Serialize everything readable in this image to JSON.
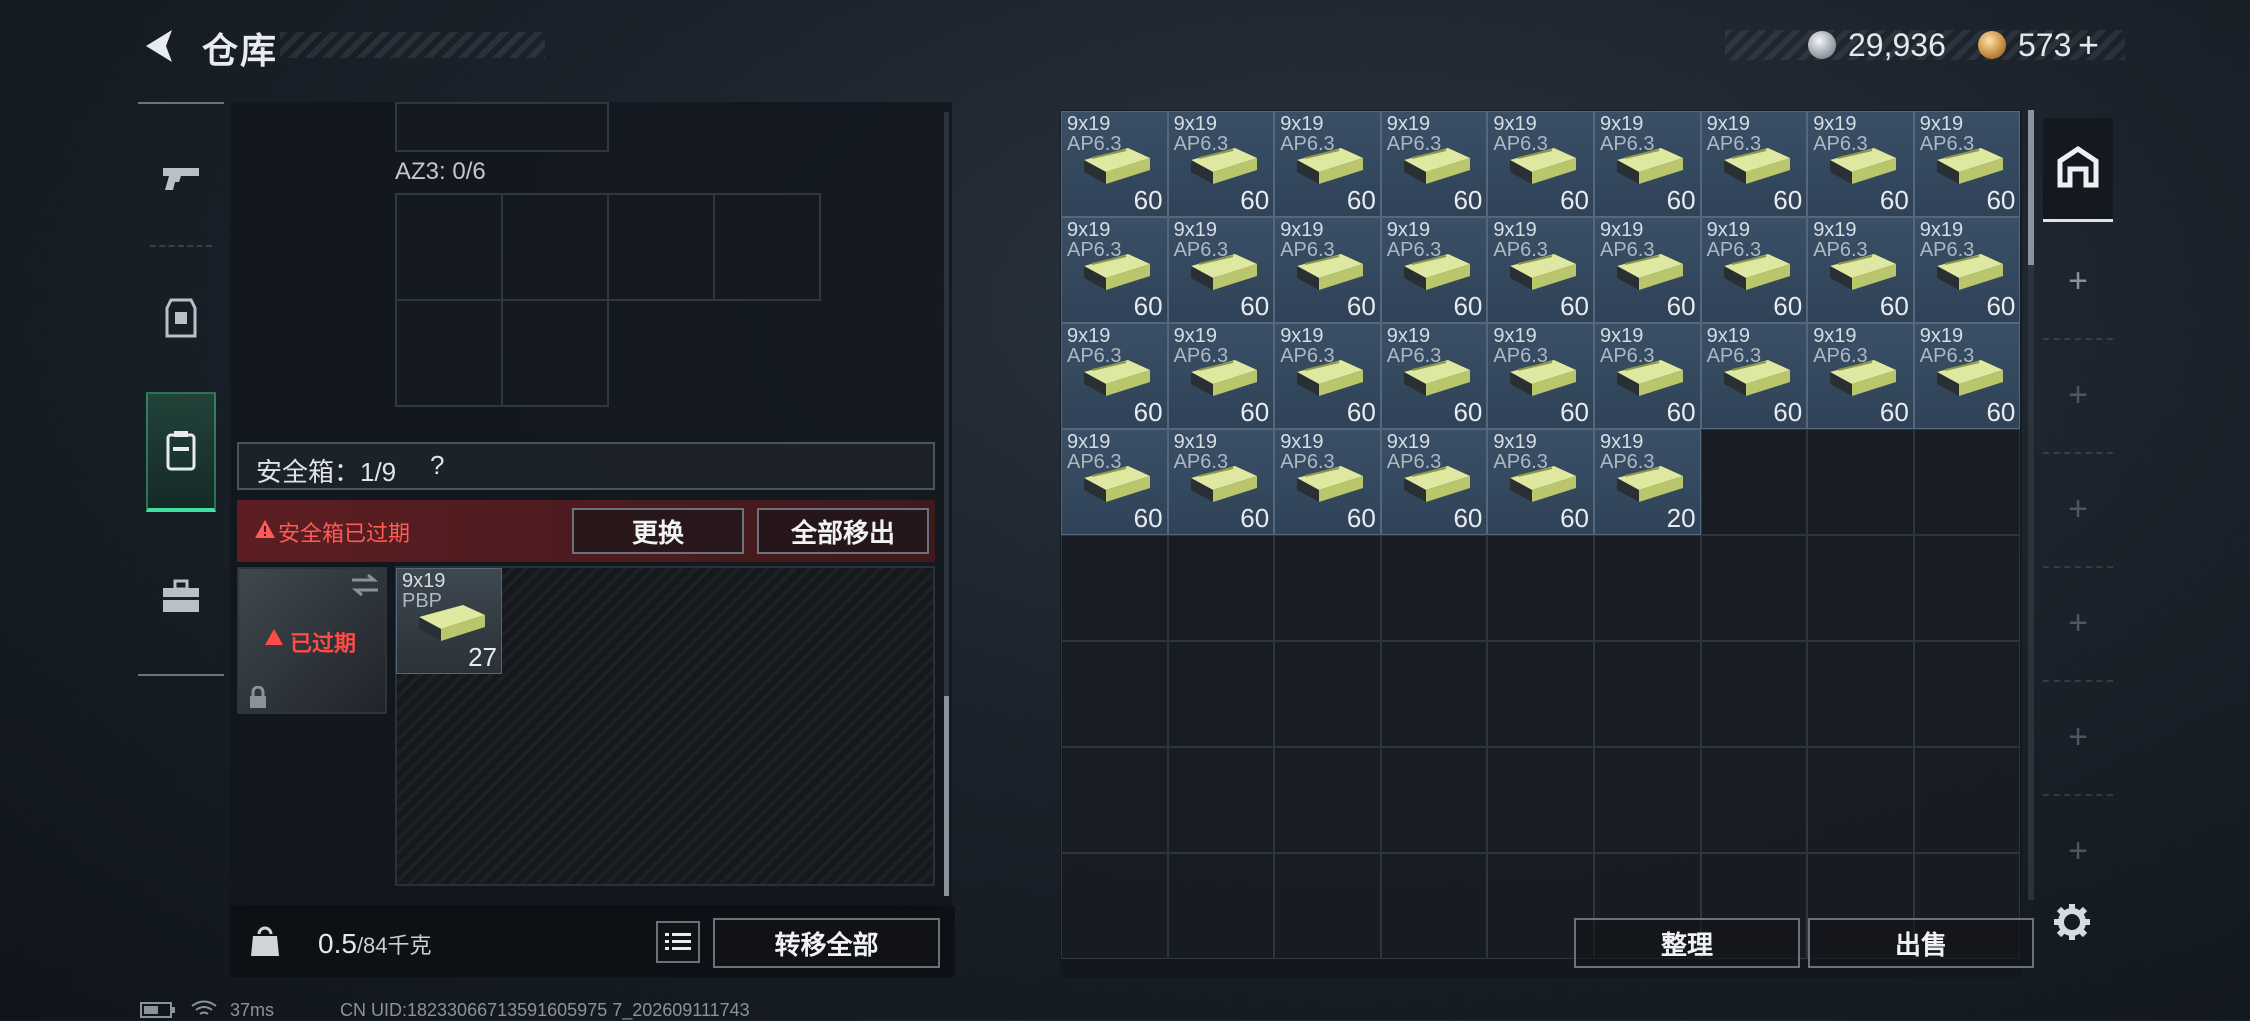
{
  "header": {
    "title": "仓库",
    "currency_silver": "29,936",
    "currency_gold": "573",
    "currency_add": "+"
  },
  "left": {
    "az3_label": "AZ3: 0/6",
    "safebox_label": "安全箱：1/9",
    "safebox_help": "?",
    "expired_warning": "安全箱已过期",
    "btn_replace": "更换",
    "btn_move_all_out": "全部移出",
    "safe_expired_badge": "已过期",
    "safe_item": {
      "name": "9x19",
      "sub": "PBP",
      "count": "27"
    },
    "weight_value": "0.5",
    "weight_unit": "/84千克",
    "btn_transfer_all": "转移全部"
  },
  "right": {
    "items": [
      {
        "name": "9x19",
        "sub": "AP6.3",
        "count": "60"
      },
      {
        "name": "9x19",
        "sub": "AP6.3",
        "count": "60"
      },
      {
        "name": "9x19",
        "sub": "AP6.3",
        "count": "60"
      },
      {
        "name": "9x19",
        "sub": "AP6.3",
        "count": "60"
      },
      {
        "name": "9x19",
        "sub": "AP6.3",
        "count": "60"
      },
      {
        "name": "9x19",
        "sub": "AP6.3",
        "count": "60"
      },
      {
        "name": "9x19",
        "sub": "AP6.3",
        "count": "60"
      },
      {
        "name": "9x19",
        "sub": "AP6.3",
        "count": "60"
      },
      {
        "name": "9x19",
        "sub": "AP6.3",
        "count": "60"
      },
      {
        "name": "9x19",
        "sub": "AP6.3",
        "count": "60"
      },
      {
        "name": "9x19",
        "sub": "AP6.3",
        "count": "60"
      },
      {
        "name": "9x19",
        "sub": "AP6.3",
        "count": "60"
      },
      {
        "name": "9x19",
        "sub": "AP6.3",
        "count": "60"
      },
      {
        "name": "9x19",
        "sub": "AP6.3",
        "count": "60"
      },
      {
        "name": "9x19",
        "sub": "AP6.3",
        "count": "60"
      },
      {
        "name": "9x19",
        "sub": "AP6.3",
        "count": "60"
      },
      {
        "name": "9x19",
        "sub": "AP6.3",
        "count": "60"
      },
      {
        "name": "9x19",
        "sub": "AP6.3",
        "count": "60"
      },
      {
        "name": "9x19",
        "sub": "AP6.3",
        "count": "60"
      },
      {
        "name": "9x19",
        "sub": "AP6.3",
        "count": "60"
      },
      {
        "name": "9x19",
        "sub": "AP6.3",
        "count": "60"
      },
      {
        "name": "9x19",
        "sub": "AP6.3",
        "count": "60"
      },
      {
        "name": "9x19",
        "sub": "AP6.3",
        "count": "60"
      },
      {
        "name": "9x19",
        "sub": "AP6.3",
        "count": "60"
      },
      {
        "name": "9x19",
        "sub": "AP6.3",
        "count": "60"
      },
      {
        "name": "9x19",
        "sub": "AP6.3",
        "count": "60"
      },
      {
        "name": "9x19",
        "sub": "AP6.3",
        "count": "60"
      },
      {
        "name": "9x19",
        "sub": "AP6.3",
        "count": "60"
      },
      {
        "name": "9x19",
        "sub": "AP6.3",
        "count": "60"
      },
      {
        "name": "9x19",
        "sub": "AP6.3",
        "count": "60"
      },
      {
        "name": "9x19",
        "sub": "AP6.3",
        "count": "60"
      },
      {
        "name": "9x19",
        "sub": "AP6.3",
        "count": "60"
      },
      {
        "name": "9x19",
        "sub": "AP6.3",
        "count": "20"
      }
    ],
    "btn_sort": "整理",
    "btn_sell": "出售"
  },
  "side_tabs": {
    "plus": "+"
  },
  "status": {
    "ping": "37ms",
    "uid": "CN UID:18233066713591605975 7_202609111743"
  },
  "colors": {
    "accent_green": "#3de0a0",
    "warning_red": "#ff5a55",
    "item_bg": "#34495f"
  }
}
